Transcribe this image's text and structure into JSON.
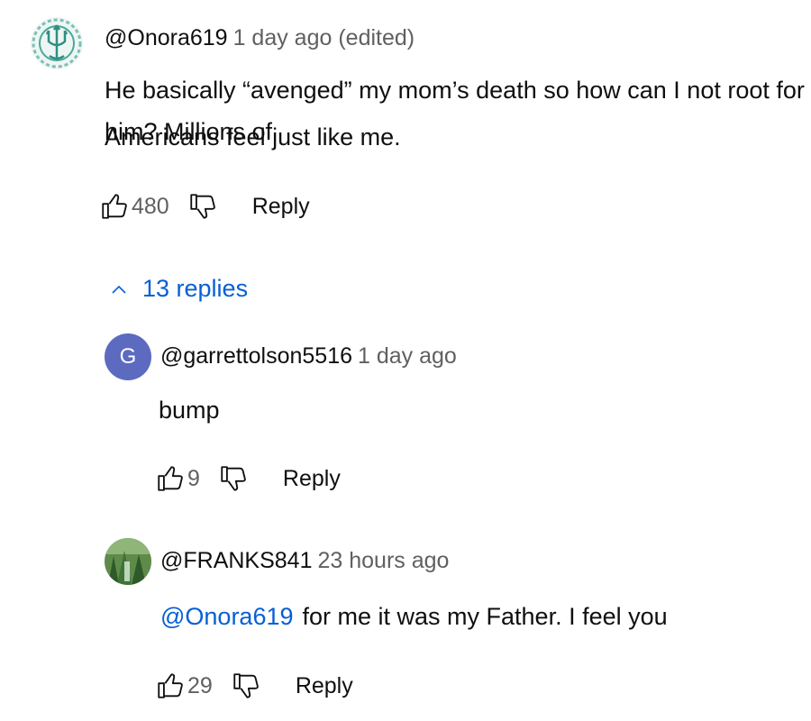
{
  "comments": {
    "top": {
      "author": "@Onora619",
      "time": "1 day ago (edited)",
      "text_line1": "He basically “avenged” my mom’s death so how can I not root for him? Millions of",
      "text_line2": "Americans feel just like me.",
      "likes": "480",
      "reply_label": "Reply",
      "avatar_icon": "trident-emblem-icon"
    },
    "replies_toggle": "13 replies",
    "replies": [
      {
        "author": "@garrettolson5516",
        "time": "1 day ago",
        "avatar_letter": "G",
        "avatar_color": "#5c6bc0",
        "text": "bump",
        "likes": "9",
        "reply_label": "Reply"
      },
      {
        "author": "@FRANKS841",
        "time": "23 hours ago",
        "mention": "@Onora619",
        "text": "for me it was my Father. I feel you",
        "likes": "29",
        "reply_label": "Reply",
        "avatar_icon": "nature-photo-icon"
      }
    ]
  },
  "colors": {
    "link": "#065fd4",
    "secondary_text": "#606060"
  }
}
